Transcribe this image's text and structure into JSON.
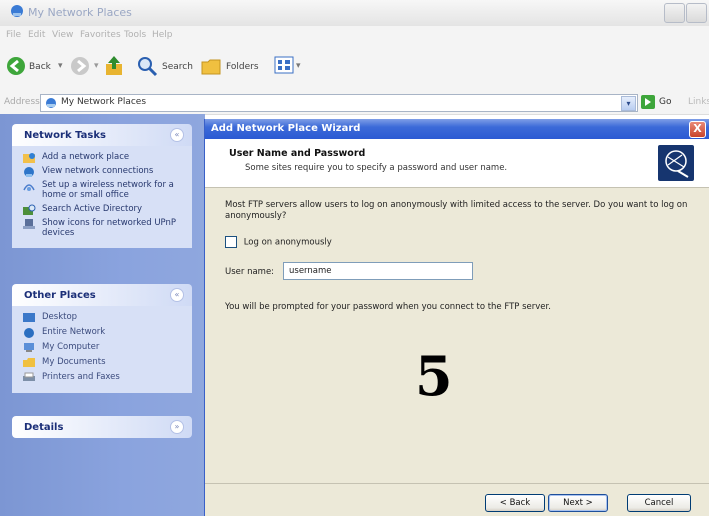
{
  "window": {
    "title": "My Network Places",
    "menu": [
      "File",
      "Edit",
      "View",
      "Favorites",
      "Tools",
      "Help"
    ],
    "toolbar": {
      "back": "Back",
      "search": "Search",
      "folders": "Folders"
    },
    "address": {
      "label": "Address",
      "value": "My Network Places",
      "go": "Go",
      "links": "Links"
    }
  },
  "sidebar": {
    "network_tasks": {
      "title": "Network Tasks",
      "items": [
        "Add a network place",
        "View network connections",
        "Set up a wireless network for a home or small office",
        "Search Active Directory",
        "Show icons for networked UPnP devices"
      ]
    },
    "other_places": {
      "title": "Other Places",
      "items": [
        "Desktop",
        "Entire Network",
        "My Computer",
        "My Documents",
        "Printers and Faxes"
      ]
    },
    "details": {
      "title": "Details"
    }
  },
  "wizard": {
    "title": "Add Network Place Wizard",
    "close": "X",
    "header": "User Name and Password",
    "subheader": "Some sites require you to specify a password and user name.",
    "intro": "Most FTP servers allow users to log on anonymously with limited access to the server.  Do you want to log on anonymously?",
    "anonymous_label": "Log on anonymously",
    "anonymous_checked": false,
    "username_label": "User name:",
    "username_value": "username",
    "prompt": "You will be prompted for your password when you connect to the FTP server.",
    "step_number": "5",
    "buttons": {
      "back": "< Back",
      "next": "Next >",
      "cancel": "Cancel"
    }
  }
}
